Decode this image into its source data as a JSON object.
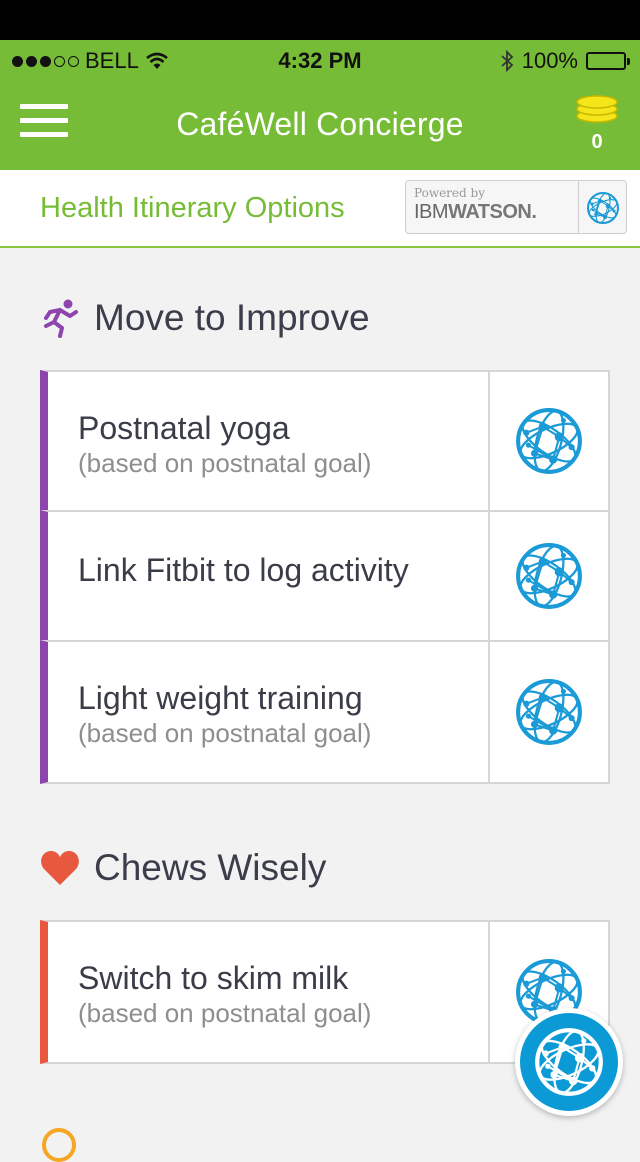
{
  "status_bar": {
    "carrier": "BELL",
    "time": "4:32 PM",
    "battery": "100%",
    "battery_level": 1.0,
    "signal_bars_filled": 3,
    "signal_bars_total": 5,
    "icons": [
      "signal-dots-icon",
      "wifi-icon",
      "bluetooth-icon",
      "battery-icon"
    ]
  },
  "navbar": {
    "title": "CaféWell Concierge",
    "coins_count": "0",
    "icons": [
      "hamburger-menu-icon",
      "coins-icon"
    ]
  },
  "subheader": {
    "title": "Health Itinerary Options",
    "watson_powered": "Powered by",
    "watson_logo_ibm": "IBM",
    "watson_logo_watson": "WATSON."
  },
  "sections": {
    "move": {
      "title": "Move to Improve",
      "icon": "running-person-icon",
      "accent": "#8e44ad",
      "items": [
        {
          "title": "Postnatal yoga",
          "subtitle": "(based on postnatal goal)"
        },
        {
          "title": "Link Fitbit to log activity",
          "subtitle": ""
        },
        {
          "title": "Light weight training",
          "subtitle": "(based on postnatal goal)"
        }
      ]
    },
    "chews": {
      "title": "Chews Wisely",
      "icon": "heart-icon",
      "accent": "#e8583f",
      "items": [
        {
          "title": "Switch to skim milk",
          "subtitle": "(based on postnatal goal)"
        }
      ]
    }
  },
  "colors": {
    "brand_green": "#77bc36",
    "watson_blue": "#1a9ad6",
    "fab_blue": "#0b9ad6",
    "page_bg": "#f2f2f2"
  },
  "fab": {
    "icon": "watson-globe-icon"
  }
}
